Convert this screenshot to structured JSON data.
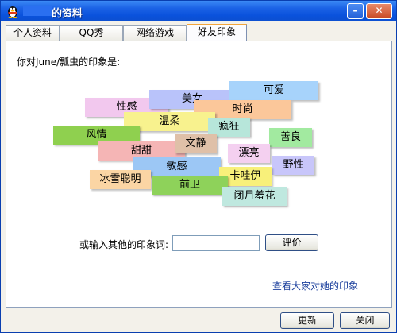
{
  "window": {
    "title": "的资料"
  },
  "tabs": [
    {
      "label": "个人资料",
      "active": false
    },
    {
      "label": "QQ秀",
      "active": false
    },
    {
      "label": "网络游戏",
      "active": false
    },
    {
      "label": "好友印象",
      "active": true
    }
  ],
  "impressions": {
    "prompt": "你对June/瓢虫的印象是:",
    "tags": [
      {
        "label": "性感",
        "color": "#f2c8ee"
      },
      {
        "label": "美女",
        "color": "#b9c3fa"
      },
      {
        "label": "可爱",
        "color": "#a7d3fb"
      },
      {
        "label": "时尚",
        "color": "#fbc79a"
      },
      {
        "label": "温柔",
        "color": "#f8f28e"
      },
      {
        "label": "疯狂",
        "color": "#b7e6da"
      },
      {
        "label": "风情",
        "color": "#8fd04f"
      },
      {
        "label": "善良",
        "color": "#a2eaa0"
      },
      {
        "label": "甜甜",
        "color": "#f5b5b5"
      },
      {
        "label": "文静",
        "color": "#dfc0a8"
      },
      {
        "label": "漂亮",
        "color": "#f4d0f0"
      },
      {
        "label": "野性",
        "color": "#c8c6fa"
      },
      {
        "label": "敏感",
        "color": "#9cc7f5"
      },
      {
        "label": "卡哇伊",
        "color": "#f8f07a"
      },
      {
        "label": "冰雪聪明",
        "color": "#fbd5a4"
      },
      {
        "label": "前卫",
        "color": "#8ed25a"
      },
      {
        "label": "闭月羞花",
        "color": "#bfe8df"
      }
    ]
  },
  "form": {
    "input_label": "或输入其他的印象词:",
    "input_value": "",
    "evaluate_label": "评价"
  },
  "links": {
    "view_all": "查看大家对她的印象"
  },
  "footer": {
    "refresh_label": "更新",
    "close_label": "关闭"
  },
  "colors": {
    "titlebar": "#0a52dc",
    "active_tab_accent": "#f3a53b",
    "link": "#1b3f9c"
  }
}
